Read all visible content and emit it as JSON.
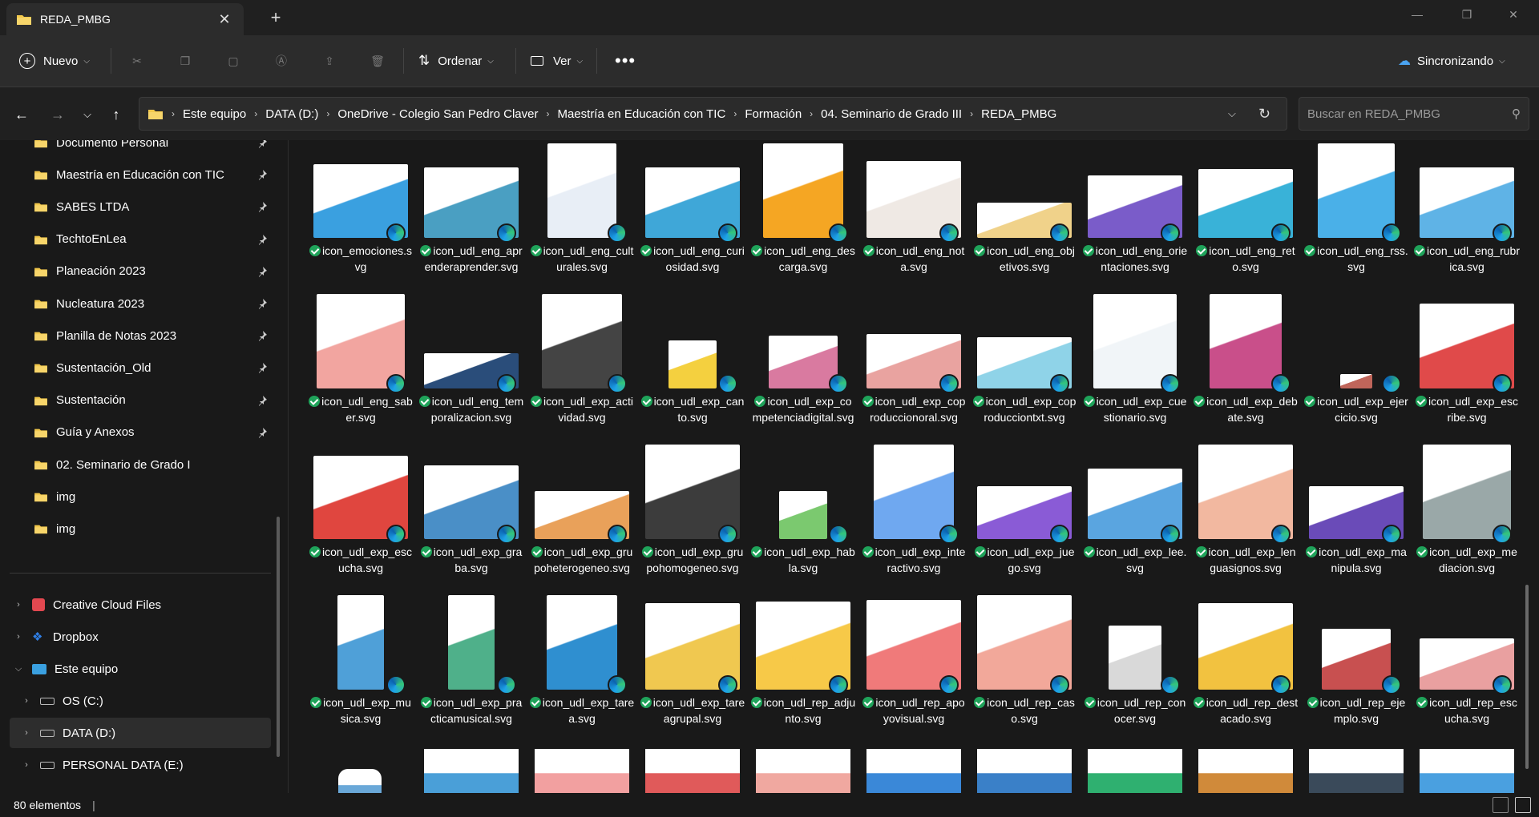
{
  "window": {
    "tab_title": "REDA_PMBG",
    "new_tab_icon": "plus-icon",
    "minimize_icon": "minimize-icon",
    "restore_icon": "restore-icon",
    "close_icon": "close-icon"
  },
  "toolbar": {
    "new_label": "Nuevo",
    "sort_label": "Ordenar",
    "view_label": "Ver",
    "sync_label": "Sincronizando",
    "icons": [
      "cut-icon",
      "copy-icon",
      "paste-icon",
      "rename-icon",
      "share-icon",
      "delete-icon"
    ],
    "more_icon": "more-icon"
  },
  "breadcrumb": [
    "Este equipo",
    "DATA (D:)",
    "OneDrive - Colegio San Pedro Claver",
    "Maestría en Educación con TIC",
    "Formación",
    "04. Seminario de Grado III",
    "REDA_PMBG"
  ],
  "search": {
    "placeholder": "Buscar en REDA_PMBG"
  },
  "sidebar": {
    "quick_access": [
      "Documento Personal",
      "Maestría en Educación con TIC",
      "SABES LTDA",
      "TechtoEnLea",
      "Planeación 2023",
      "Nucleatura 2023",
      "Planilla de Notas 2023",
      "Sustentación_Old",
      "Sustentación",
      "Guía y Anexos",
      "02. Seminario de Grado I",
      "img",
      "img"
    ],
    "pinned": [
      true,
      true,
      true,
      true,
      true,
      true,
      true,
      true,
      true,
      true,
      false,
      false,
      false
    ],
    "locations": [
      {
        "label": "Creative Cloud Files",
        "icon": "creative-cloud-icon",
        "expander": ">"
      },
      {
        "label": "Dropbox",
        "icon": "dropbox-icon",
        "expander": ">"
      },
      {
        "label": "Este equipo",
        "icon": "computer-icon",
        "expander": "v"
      },
      {
        "label": "OS (C:)",
        "icon": "drive-icon",
        "expander": ">"
      },
      {
        "label": "DATA (D:)",
        "icon": "drive-icon",
        "expander": ">"
      },
      {
        "label": "PERSONAL DATA (E:)",
        "icon": "drive-icon",
        "expander": ">"
      }
    ]
  },
  "files": [
    {
      "name": "icon_emociones.svg",
      "color": "#3aa0e0",
      "w": 118,
      "h": 92
    },
    {
      "name": "icon_udl_eng_aprenderaprender.svg",
      "color": "#4a9fc2",
      "w": 118,
      "h": 88
    },
    {
      "name": "icon_udl_eng_culturales.svg",
      "color": "#e8eef6",
      "w": 86,
      "h": 118
    },
    {
      "name": "icon_udl_eng_curiosidad.svg",
      "color": "#3fa7d8",
      "w": 118,
      "h": 88
    },
    {
      "name": "icon_udl_eng_descarga.svg",
      "color": "#f5a623",
      "w": 100,
      "h": 118
    },
    {
      "name": "icon_udl_eng_nota.svg",
      "color": "#efe9e4",
      "w": 118,
      "h": 96
    },
    {
      "name": "icon_udl_eng_objetivos.svg",
      "color": "#f0d28a",
      "w": 118,
      "h": 44
    },
    {
      "name": "icon_udl_eng_orientaciones.svg",
      "color": "#7a5cc9",
      "w": 118,
      "h": 78
    },
    {
      "name": "icon_udl_eng_reto.svg",
      "color": "#39b2d8",
      "w": 118,
      "h": 86
    },
    {
      "name": "icon_udl_eng_rss.svg",
      "color": "#4ab0e8",
      "w": 96,
      "h": 118
    },
    {
      "name": "icon_udl_eng_rubrica.svg",
      "color": "#5fb3e6",
      "w": 118,
      "h": 88
    },
    {
      "name": "icon_udl_eng_saber.svg",
      "color": "#f2a5a0",
      "w": 110,
      "h": 118
    },
    {
      "name": "icon_udl_eng_temporalizacion.svg",
      "color": "#2a4d7a",
      "w": 118,
      "h": 44
    },
    {
      "name": "icon_udl_exp_actividad.svg",
      "color": "#444444",
      "w": 100,
      "h": 118
    },
    {
      "name": "icon_udl_exp_canto.svg",
      "color": "#f4d03f",
      "w": 60,
      "h": 60
    },
    {
      "name": "icon_udl_exp_competenciadigital.svg",
      "color": "#d97aa0",
      "w": 86,
      "h": 66
    },
    {
      "name": "icon_udl_exp_coproduccionoral.svg",
      "color": "#e9a3a0",
      "w": 118,
      "h": 68
    },
    {
      "name": "icon_udl_exp_coproducciontxt.svg",
      "color": "#8fd3e8",
      "w": 118,
      "h": 64
    },
    {
      "name": "icon_udl_exp_cuestionario.svg",
      "color": "#f1f5f8",
      "w": 104,
      "h": 118
    },
    {
      "name": "icon_udl_exp_debate.svg",
      "color": "#c94f8a",
      "w": 90,
      "h": 118
    },
    {
      "name": "icon_udl_exp_ejercicio.svg",
      "color": "#c0655a",
      "w": 40,
      "h": 18
    },
    {
      "name": "icon_udl_exp_escribe.svg",
      "color": "#e04a4a",
      "w": 118,
      "h": 106
    },
    {
      "name": "icon_udl_exp_escucha.svg",
      "color": "#e0463f",
      "w": 118,
      "h": 104
    },
    {
      "name": "icon_udl_exp_graba.svg",
      "color": "#4a8fc7",
      "w": 118,
      "h": 92
    },
    {
      "name": "icon_udl_exp_grupoheterogeneo.svg",
      "color": "#e9a15a",
      "w": 118,
      "h": 60
    },
    {
      "name": "icon_udl_exp_grupohomogeneo.svg",
      "color": "#3c3c3c",
      "w": 118,
      "h": 118
    },
    {
      "name": "icon_udl_exp_habla.svg",
      "color": "#7bc96f",
      "w": 60,
      "h": 60
    },
    {
      "name": "icon_udl_exp_interactivo.svg",
      "color": "#6fa8f0",
      "w": 100,
      "h": 118
    },
    {
      "name": "icon_udl_exp_juego.svg",
      "color": "#8a5bd6",
      "w": 118,
      "h": 66
    },
    {
      "name": "icon_udl_exp_lee.svg",
      "color": "#5aa5e0",
      "w": 118,
      "h": 88
    },
    {
      "name": "icon_udl_exp_lenguasignos.svg",
      "color": "#f2b8a0",
      "w": 118,
      "h": 118
    },
    {
      "name": "icon_udl_exp_manipula.svg",
      "color": "#6a4bb8",
      "w": 118,
      "h": 66
    },
    {
      "name": "icon_udl_exp_mediacion.svg",
      "color": "#9aa8a8",
      "w": 110,
      "h": 118
    },
    {
      "name": "icon_udl_exp_musica.svg",
      "color": "#4fa0d8",
      "w": 58,
      "h": 118
    },
    {
      "name": "icon_udl_exp_practicamusical.svg",
      "color": "#4fb08a",
      "w": 58,
      "h": 118
    },
    {
      "name": "icon_udl_exp_tarea.svg",
      "color": "#2f8fd0",
      "w": 88,
      "h": 118
    },
    {
      "name": "icon_udl_exp_tareagrupal.svg",
      "color": "#f0c850",
      "w": 118,
      "h": 108
    },
    {
      "name": "icon_udl_rep_adjunto.svg",
      "color": "#f7c948",
      "w": 118,
      "h": 110
    },
    {
      "name": "icon_udl_rep_apoyovisual.svg",
      "color": "#f07a7a",
      "w": 118,
      "h": 112
    },
    {
      "name": "icon_udl_rep_caso.svg",
      "color": "#f2a89a",
      "w": 118,
      "h": 118
    },
    {
      "name": "icon_udl_rep_conocer.svg",
      "color": "#d9d9d9",
      "w": 66,
      "h": 80
    },
    {
      "name": "icon_udl_rep_destacado.svg",
      "color": "#f2c240",
      "w": 118,
      "h": 108
    },
    {
      "name": "icon_udl_rep_ejemplo.svg",
      "color": "#c85050",
      "w": 86,
      "h": 76
    },
    {
      "name": "icon_udl_rep_escucha.svg",
      "color": "#e9a0a0",
      "w": 118,
      "h": 64
    }
  ],
  "partial_row_colors": [
    "#4a9fd8",
    "#f2a0a0",
    "#e05a5a",
    "#f0a8a0",
    "#3a88d8",
    "#3a80c8",
    "#2fb070",
    "#d08a3a",
    "#3a4a5a",
    "#4aa0e0"
  ],
  "status": {
    "item_count": "80 elementos"
  }
}
